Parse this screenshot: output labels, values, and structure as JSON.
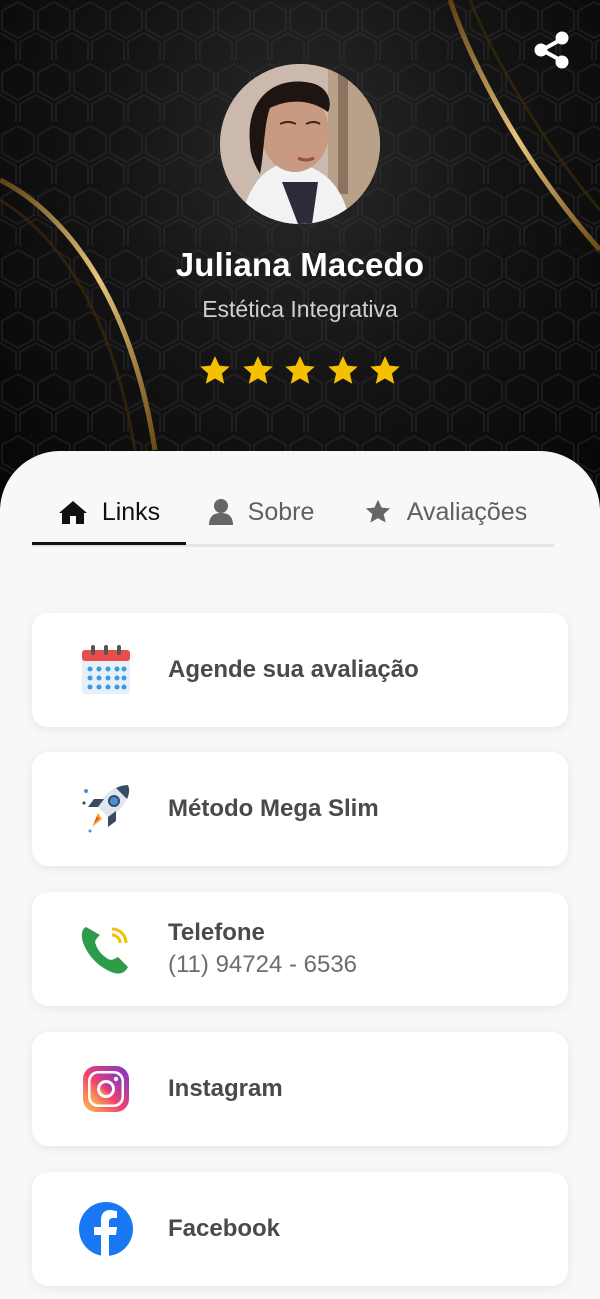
{
  "profile": {
    "name": "Juliana Macedo",
    "role": "Estética Integrativa",
    "rating": 5
  },
  "tabs": [
    {
      "label": "Links",
      "icon": "home-icon",
      "active": true
    },
    {
      "label": "Sobre",
      "icon": "user-icon",
      "active": false
    },
    {
      "label": "Avaliações",
      "icon": "star-icon",
      "active": false
    }
  ],
  "links": [
    {
      "title": "Agende sua avaliação",
      "icon": "calendar-icon"
    },
    {
      "title": "Método Mega Slim",
      "icon": "rocket-icon"
    },
    {
      "title": "Telefone",
      "subtitle": "(11) 94724 - 6536",
      "icon": "phone-icon"
    },
    {
      "title": "Instagram",
      "icon": "instagram-icon"
    },
    {
      "title": "Facebook",
      "icon": "facebook-icon"
    }
  ],
  "colors": {
    "hero_bg": "#0a0a0a",
    "gold": "#c9a25a",
    "star": "#f5c000",
    "card_bg": "#ffffff",
    "page_bg": "#f8f8f8",
    "facebook": "#1877f2",
    "phone": "#2e9b4a"
  }
}
